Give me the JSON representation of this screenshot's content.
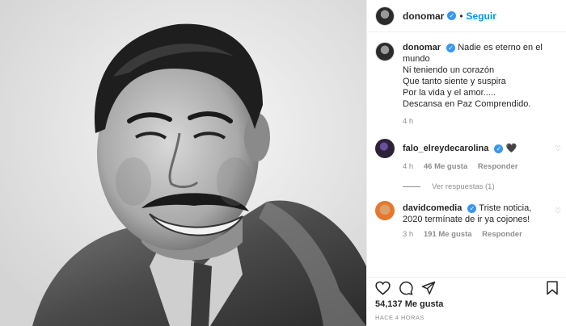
{
  "post": {
    "author": "donomar",
    "follow_label": "Seguir",
    "separator": "•"
  },
  "caption": {
    "username": "donomar",
    "lines": [
      "Nadie es eterno en el mundo",
      "Ni teniendo un corazón",
      "Que tanto siente y suspira",
      "Por la vida y el amor.....",
      "Descansa en Paz Comprendido."
    ],
    "time": "4 h"
  },
  "comments": [
    {
      "username": "falo_elreydecarolina",
      "text": "🖤",
      "time": "4 h",
      "likes": "46 Me gusta",
      "reply": "Responder",
      "view_replies": "Ver respuestas (1)"
    },
    {
      "username": "davidcomedia",
      "text": "Triste noticia, 2020 termínate de ir ya cojones!",
      "time": "3 h",
      "likes": "191 Me gusta",
      "reply": "Responder"
    }
  ],
  "footer": {
    "likes": "54,137 Me gusta",
    "ago": "HACE 4 HORAS"
  },
  "icons": [
    "heart-icon",
    "comment-icon",
    "share-icon",
    "bookmark-icon",
    "verified-icon"
  ],
  "colors": {
    "link": "#0095f6",
    "verified": "#3897f0",
    "muted": "#8e8e8e"
  }
}
